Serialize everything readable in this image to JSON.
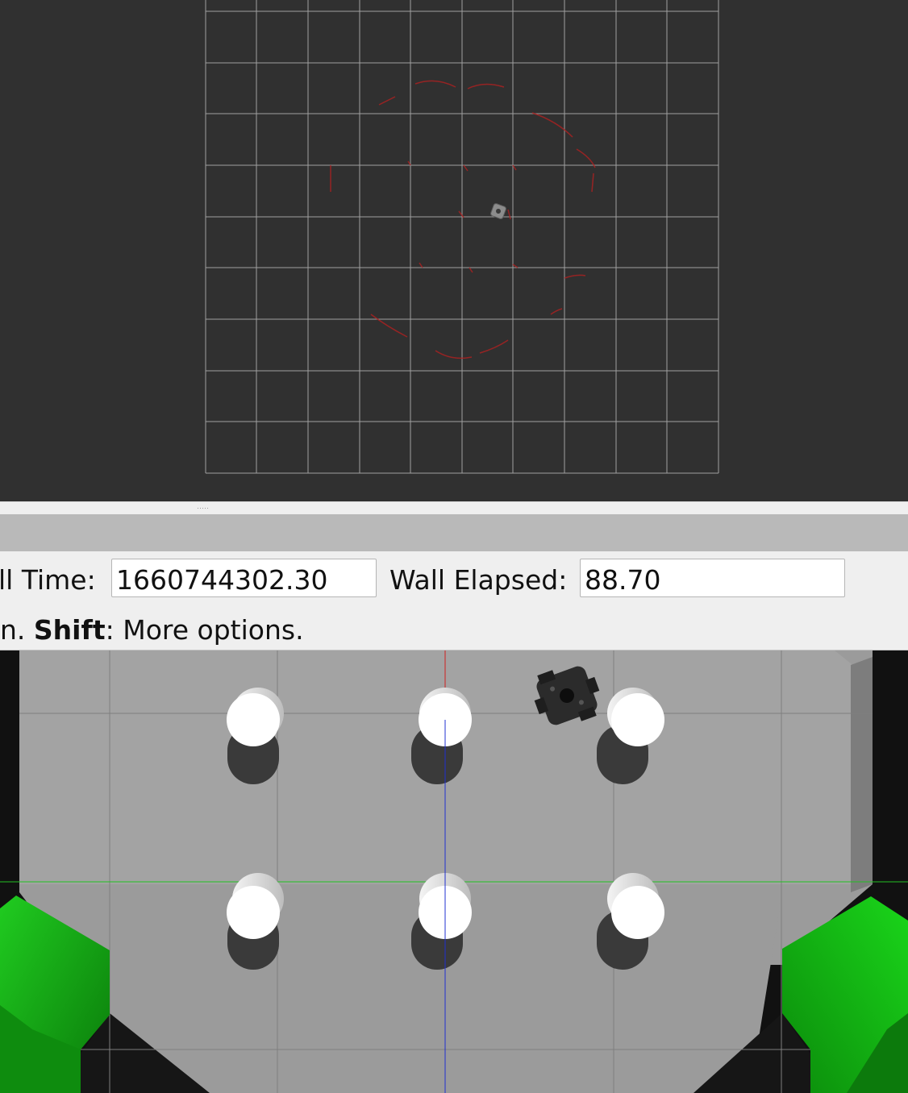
{
  "time_panel": {
    "wall_time_label": "ll Time:",
    "wall_time_value": "1660744302.30",
    "wall_elapsed_label": "Wall Elapsed:",
    "wall_elapsed_value": "88.70",
    "hint_prefix": "n. ",
    "hint_key": "Shift",
    "hint_suffix": ": More options."
  },
  "colors": {
    "rviz_background": "#303030",
    "rviz_grid": "#a0a0a0",
    "laser_scan": "#b02020",
    "gazebo_floor": "#9a9a9a",
    "gazebo_green_block": "#17b017",
    "axis_x": "#d02020",
    "axis_y": "#22c022",
    "axis_z": "#2030d0"
  },
  "icons": {
    "robot_rviz": "turtlebot-icon",
    "robot_gazebo": "turtlebot-model"
  }
}
